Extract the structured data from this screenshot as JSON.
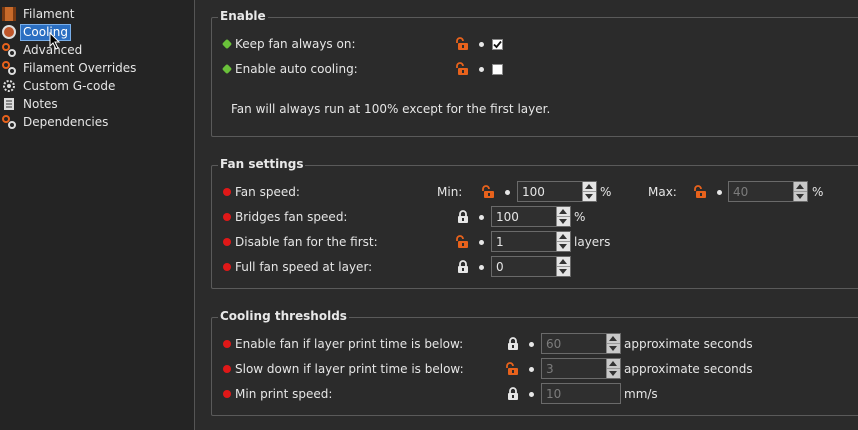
{
  "sidebar": {
    "items": [
      {
        "label": "Filament",
        "icon": "filament-spool-icon",
        "selected": false
      },
      {
        "label": "Cooling",
        "icon": "fan-icon",
        "selected": true
      },
      {
        "label": "Advanced",
        "icon": "wrench-icon",
        "selected": false
      },
      {
        "label": "Filament Overrides",
        "icon": "wrench-icon",
        "selected": false
      },
      {
        "label": "Custom G-code",
        "icon": "cog-icon",
        "selected": false
      },
      {
        "label": "Notes",
        "icon": "note-icon",
        "selected": false
      },
      {
        "label": "Dependencies",
        "icon": "wrench-icon",
        "selected": false
      }
    ]
  },
  "enable": {
    "title": "Enable",
    "keep_fan_label": "Keep fan always on:",
    "keep_fan_checked": true,
    "auto_cooling_label": "Enable auto cooling:",
    "auto_cooling_checked": false,
    "description": "Fan will always run at 100% except for the first layer."
  },
  "fan_settings": {
    "title": "Fan settings",
    "fan_speed_label": "Fan speed:",
    "min_label": "Min:",
    "min_value": "100",
    "min_unit": "%",
    "max_label": "Max:",
    "max_value": "40",
    "max_unit": "%",
    "bridges_label": "Bridges fan speed:",
    "bridges_value": "100",
    "bridges_unit": "%",
    "disable_first_label": "Disable fan for the first:",
    "disable_first_value": "1",
    "disable_first_unit": "layers",
    "full_speed_label": "Full fan speed at layer:",
    "full_speed_value": "0"
  },
  "cooling_thresholds": {
    "title": "Cooling thresholds",
    "enable_fan_label": "Enable fan if layer print time is below:",
    "enable_fan_value": "60",
    "enable_fan_unit": "approximate seconds",
    "slow_down_label": "Slow down if layer print time is below:",
    "slow_down_value": "3",
    "slow_down_unit": "approximate seconds",
    "min_speed_label": "Min print speed:",
    "min_speed_value": "10",
    "min_speed_unit": "mm/s"
  },
  "colors": {
    "accent": "#2b6fc2",
    "unlocked": "#e8621c",
    "system_value": "#6ac13a",
    "modified_value": "#e01818"
  }
}
